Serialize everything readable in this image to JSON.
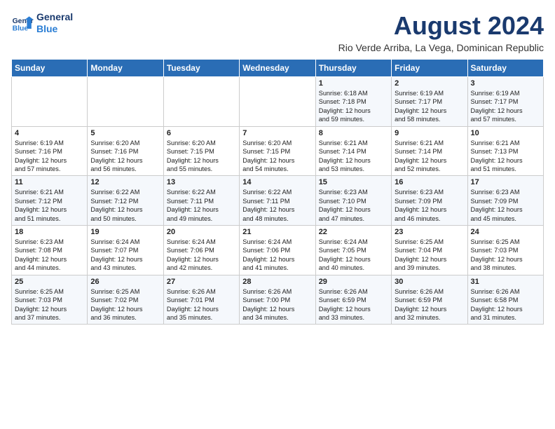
{
  "header": {
    "logo_line1": "General",
    "logo_line2": "Blue",
    "month_title": "August 2024",
    "subtitle": "Rio Verde Arriba, La Vega, Dominican Republic"
  },
  "weekdays": [
    "Sunday",
    "Monday",
    "Tuesday",
    "Wednesday",
    "Thursday",
    "Friday",
    "Saturday"
  ],
  "weeks": [
    [
      {
        "day": "",
        "content": ""
      },
      {
        "day": "",
        "content": ""
      },
      {
        "day": "",
        "content": ""
      },
      {
        "day": "",
        "content": ""
      },
      {
        "day": "1",
        "content": "Sunrise: 6:18 AM\nSunset: 7:18 PM\nDaylight: 12 hours\nand 59 minutes."
      },
      {
        "day": "2",
        "content": "Sunrise: 6:19 AM\nSunset: 7:17 PM\nDaylight: 12 hours\nand 58 minutes."
      },
      {
        "day": "3",
        "content": "Sunrise: 6:19 AM\nSunset: 7:17 PM\nDaylight: 12 hours\nand 57 minutes."
      }
    ],
    [
      {
        "day": "4",
        "content": "Sunrise: 6:19 AM\nSunset: 7:16 PM\nDaylight: 12 hours\nand 57 minutes."
      },
      {
        "day": "5",
        "content": "Sunrise: 6:20 AM\nSunset: 7:16 PM\nDaylight: 12 hours\nand 56 minutes."
      },
      {
        "day": "6",
        "content": "Sunrise: 6:20 AM\nSunset: 7:15 PM\nDaylight: 12 hours\nand 55 minutes."
      },
      {
        "day": "7",
        "content": "Sunrise: 6:20 AM\nSunset: 7:15 PM\nDaylight: 12 hours\nand 54 minutes."
      },
      {
        "day": "8",
        "content": "Sunrise: 6:21 AM\nSunset: 7:14 PM\nDaylight: 12 hours\nand 53 minutes."
      },
      {
        "day": "9",
        "content": "Sunrise: 6:21 AM\nSunset: 7:14 PM\nDaylight: 12 hours\nand 52 minutes."
      },
      {
        "day": "10",
        "content": "Sunrise: 6:21 AM\nSunset: 7:13 PM\nDaylight: 12 hours\nand 51 minutes."
      }
    ],
    [
      {
        "day": "11",
        "content": "Sunrise: 6:21 AM\nSunset: 7:12 PM\nDaylight: 12 hours\nand 51 minutes."
      },
      {
        "day": "12",
        "content": "Sunrise: 6:22 AM\nSunset: 7:12 PM\nDaylight: 12 hours\nand 50 minutes."
      },
      {
        "day": "13",
        "content": "Sunrise: 6:22 AM\nSunset: 7:11 PM\nDaylight: 12 hours\nand 49 minutes."
      },
      {
        "day": "14",
        "content": "Sunrise: 6:22 AM\nSunset: 7:11 PM\nDaylight: 12 hours\nand 48 minutes."
      },
      {
        "day": "15",
        "content": "Sunrise: 6:23 AM\nSunset: 7:10 PM\nDaylight: 12 hours\nand 47 minutes."
      },
      {
        "day": "16",
        "content": "Sunrise: 6:23 AM\nSunset: 7:09 PM\nDaylight: 12 hours\nand 46 minutes."
      },
      {
        "day": "17",
        "content": "Sunrise: 6:23 AM\nSunset: 7:09 PM\nDaylight: 12 hours\nand 45 minutes."
      }
    ],
    [
      {
        "day": "18",
        "content": "Sunrise: 6:23 AM\nSunset: 7:08 PM\nDaylight: 12 hours\nand 44 minutes."
      },
      {
        "day": "19",
        "content": "Sunrise: 6:24 AM\nSunset: 7:07 PM\nDaylight: 12 hours\nand 43 minutes."
      },
      {
        "day": "20",
        "content": "Sunrise: 6:24 AM\nSunset: 7:06 PM\nDaylight: 12 hours\nand 42 minutes."
      },
      {
        "day": "21",
        "content": "Sunrise: 6:24 AM\nSunset: 7:06 PM\nDaylight: 12 hours\nand 41 minutes."
      },
      {
        "day": "22",
        "content": "Sunrise: 6:24 AM\nSunset: 7:05 PM\nDaylight: 12 hours\nand 40 minutes."
      },
      {
        "day": "23",
        "content": "Sunrise: 6:25 AM\nSunset: 7:04 PM\nDaylight: 12 hours\nand 39 minutes."
      },
      {
        "day": "24",
        "content": "Sunrise: 6:25 AM\nSunset: 7:03 PM\nDaylight: 12 hours\nand 38 minutes."
      }
    ],
    [
      {
        "day": "25",
        "content": "Sunrise: 6:25 AM\nSunset: 7:03 PM\nDaylight: 12 hours\nand 37 minutes."
      },
      {
        "day": "26",
        "content": "Sunrise: 6:25 AM\nSunset: 7:02 PM\nDaylight: 12 hours\nand 36 minutes."
      },
      {
        "day": "27",
        "content": "Sunrise: 6:26 AM\nSunset: 7:01 PM\nDaylight: 12 hours\nand 35 minutes."
      },
      {
        "day": "28",
        "content": "Sunrise: 6:26 AM\nSunset: 7:00 PM\nDaylight: 12 hours\nand 34 minutes."
      },
      {
        "day": "29",
        "content": "Sunrise: 6:26 AM\nSunset: 6:59 PM\nDaylight: 12 hours\nand 33 minutes."
      },
      {
        "day": "30",
        "content": "Sunrise: 6:26 AM\nSunset: 6:59 PM\nDaylight: 12 hours\nand 32 minutes."
      },
      {
        "day": "31",
        "content": "Sunrise: 6:26 AM\nSunset: 6:58 PM\nDaylight: 12 hours\nand 31 minutes."
      }
    ]
  ]
}
